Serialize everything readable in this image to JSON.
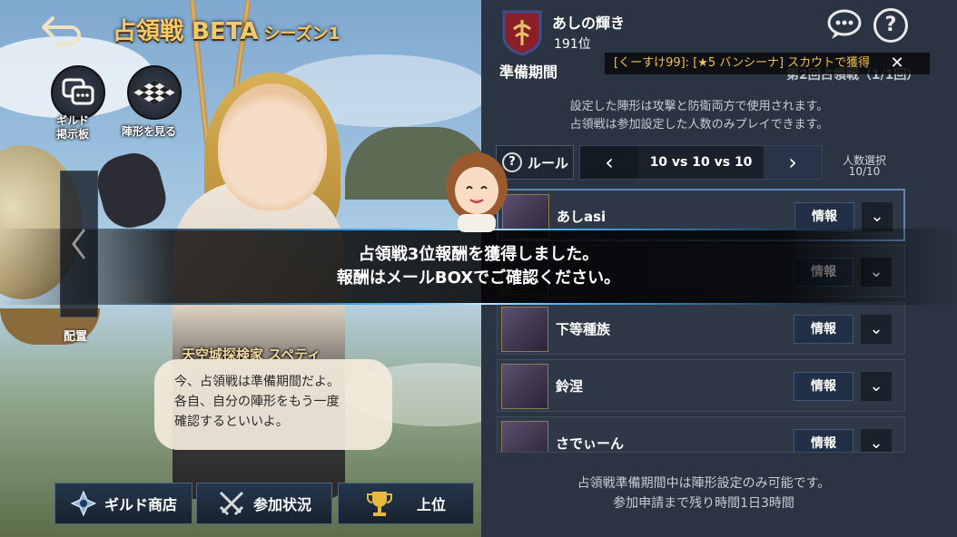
{
  "header": {
    "title": "占領戦",
    "title_beta": "BETA",
    "season": "シーズン1"
  },
  "left": {
    "guild_board_label_1": "ギルド",
    "guild_board_label_2": "掲示板",
    "view_formation_label": "陣形を見る",
    "deploy_label": "配置",
    "speaker_name": "天空城探検家 スペティ",
    "dialogue": [
      "今、占領戦は準備期間だよ。",
      "各自、自分の陣形をもう一度",
      "確認するといいよ。"
    ]
  },
  "bottom_buttons": {
    "guild_shop": "ギルド商店",
    "participation": "参加状況",
    "ranking": "上位"
  },
  "guild": {
    "name": "あしの輝き",
    "rank": "191位"
  },
  "panel": {
    "period": "準備期間",
    "battle_label": "第2回占領戦（1/1回）",
    "notice": "[くーすけ99]: [★5 バンシーナ] スカウトで獲得",
    "notice_close": "✕",
    "description": [
      "設定した陣形は攻撃と防衛両方で使用されます。",
      "占領戦は参加設定した人数のみプレイできます。"
    ],
    "rule_label": "ルール",
    "matchup": "10 vs 10 vs 10",
    "headcount_label": "人数選択",
    "headcount_value": "10/10",
    "footer": [
      "占領戦準備期間中は陣形設定のみ可能です。",
      "参加申請まで残り時間1日3時間"
    ]
  },
  "members": [
    {
      "name": "あしasi",
      "info": "情報",
      "selected": true
    },
    {
      "name": "",
      "info": "情報",
      "selected": false
    },
    {
      "name": "下等種族",
      "info": "情報",
      "selected": false
    },
    {
      "name": "鈴涅",
      "info": "情報",
      "selected": false
    },
    {
      "name": "さでぃーん",
      "info": "情報",
      "selected": false
    }
  ],
  "overlay": {
    "line1": "占領戦3位報酬を獲得しました。",
    "line2": "報酬はメールBOXでご確認ください。"
  },
  "icons": [
    "back-arrow-icon",
    "chat-board-icon",
    "checkerboard-icon",
    "chevron-left-icon",
    "help-icon",
    "chat-icon",
    "guild-emblem-icon",
    "shop-icon",
    "swords-icon",
    "trophy-icon",
    "chevron-down-icon",
    "chevron-right-icon"
  ],
  "colors": {
    "title_gold": "#f3c96a",
    "notice_yellow": "#f0c24a",
    "panel_bg": "#2b3442",
    "banner_glow": "#49b4ff"
  }
}
